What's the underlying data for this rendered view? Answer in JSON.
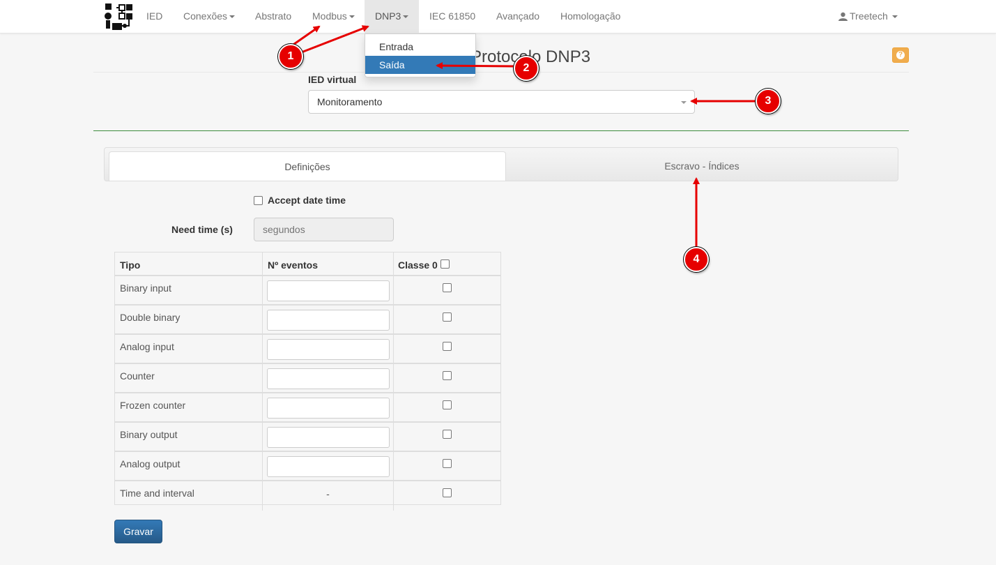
{
  "nav": {
    "items": [
      "IED",
      "Conexões",
      "Abstrato",
      "Modbus",
      "DNP3",
      "IEC 61850",
      "Avançado",
      "Homologação"
    ],
    "user": "Treetech",
    "dropdown": [
      "Entrada",
      "Saída"
    ]
  },
  "page": {
    "title": "Protocolo DNP3",
    "help_icon": "question-icon"
  },
  "form": {
    "ied_label": "IED virtual",
    "ied_value": "Monitoramento",
    "accept_label": "Accept date time",
    "accept_checked": false,
    "needtime_label": "Need time (s)",
    "needtime_placeholder": "segundos"
  },
  "tabs": [
    "Definições",
    "Escravo - Índices"
  ],
  "table": {
    "headers": [
      "Tipo",
      "Nº eventos",
      "Classe 0"
    ],
    "rows": [
      {
        "tipo": "Binary input",
        "input": true
      },
      {
        "tipo": "Double binary",
        "input": true
      },
      {
        "tipo": "Analog input",
        "input": true
      },
      {
        "tipo": "Counter",
        "input": true
      },
      {
        "tipo": "Frozen counter",
        "input": true
      },
      {
        "tipo": "Binary output",
        "input": true
      },
      {
        "tipo": "Analog output",
        "input": true
      },
      {
        "tipo": "Time and interval",
        "input": false,
        "eventos": "-"
      }
    ]
  },
  "buttons": {
    "save": "Gravar"
  },
  "annotations": [
    "1",
    "2",
    "3",
    "4"
  ],
  "colors": {
    "primary": "#337ab7",
    "help": "#f0ad4e",
    "annotation": "#e60000",
    "divider": "#3c8c3c"
  }
}
